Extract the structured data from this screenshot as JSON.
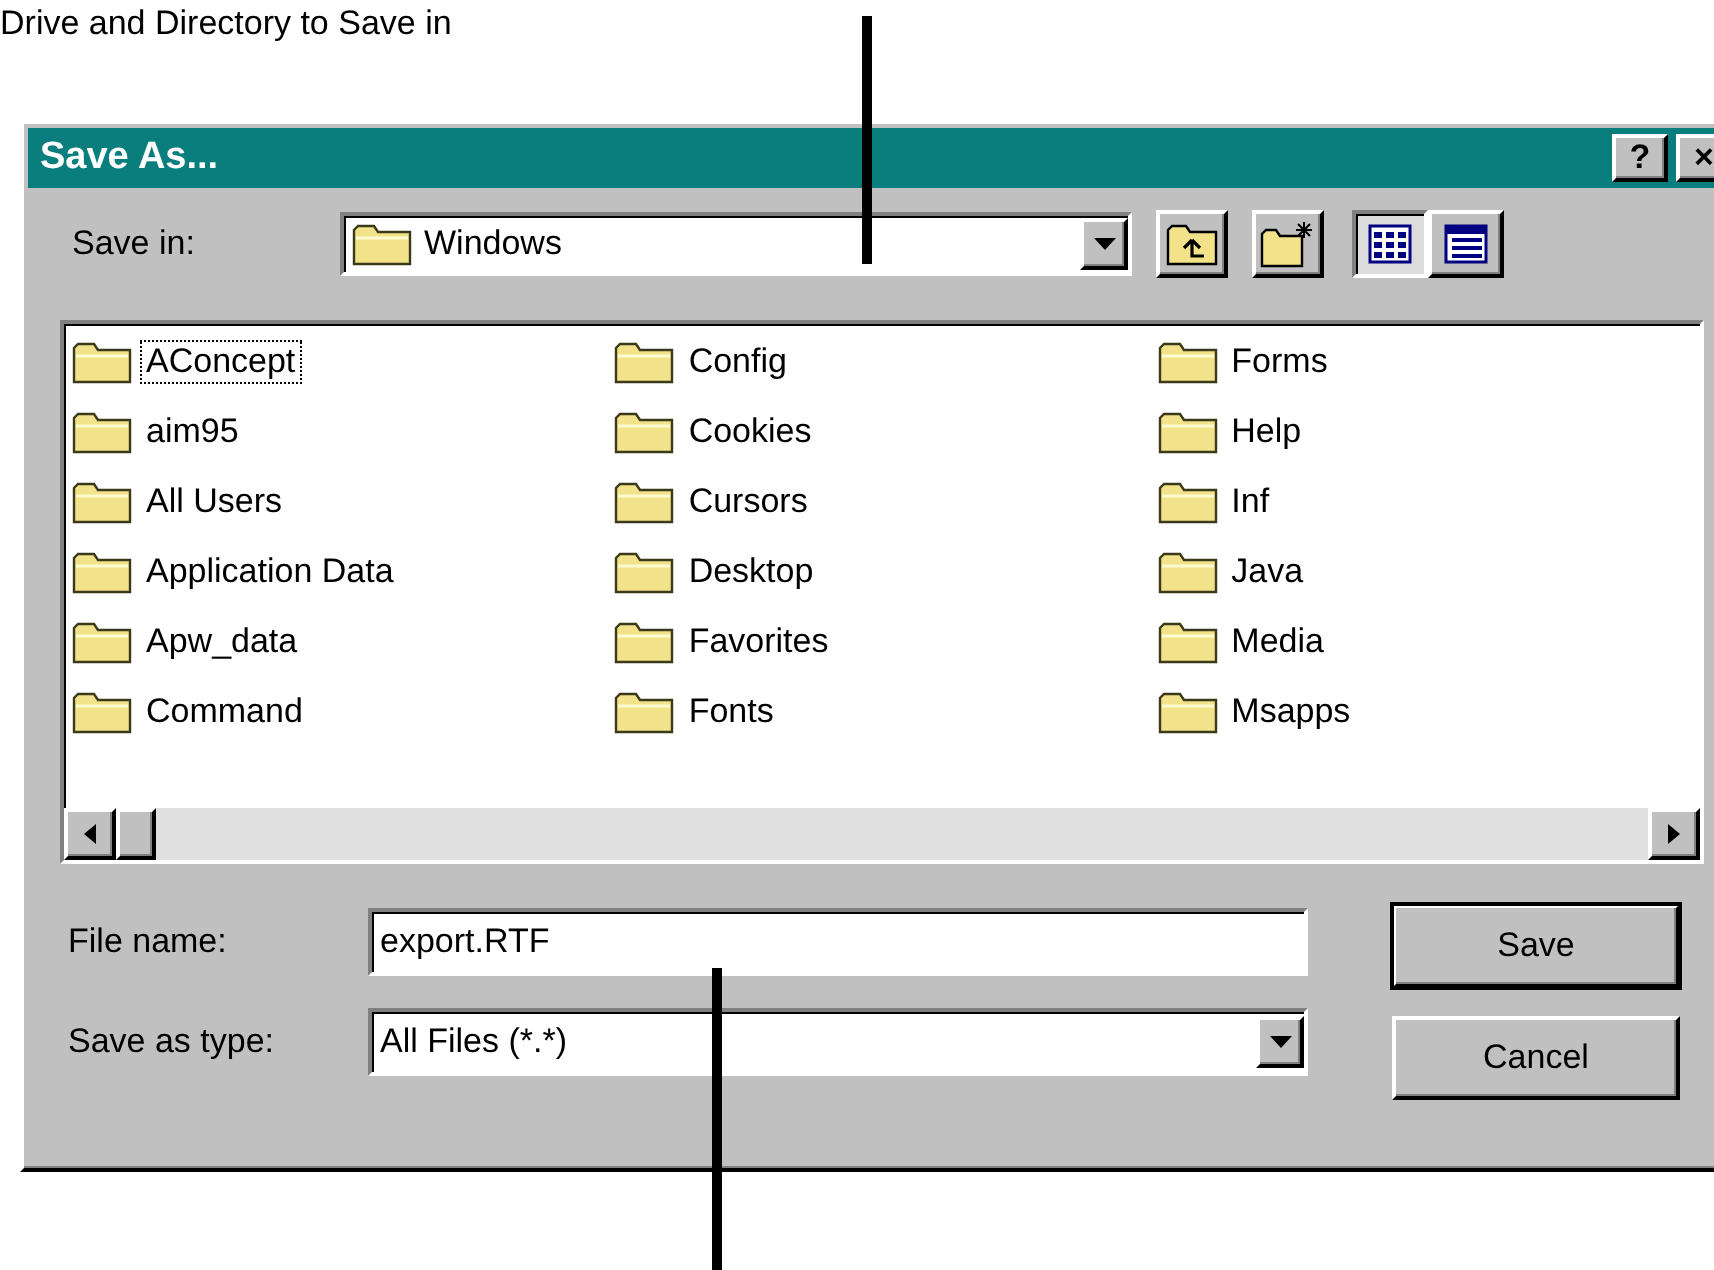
{
  "annotation_top": {
    "text": "Drive and Directory to Save in"
  },
  "window": {
    "title": "Save As...",
    "help_button": "?",
    "close_button": "×"
  },
  "save_in": {
    "label": "Save in:",
    "value": "Windows"
  },
  "view_buttons": [
    {
      "kind": "list",
      "selected": true
    },
    {
      "kind": "details",
      "selected": false
    }
  ],
  "folders": [
    {
      "name": "AConcept",
      "focused": true
    },
    {
      "name": "aim95",
      "focused": false
    },
    {
      "name": "All Users",
      "focused": false
    },
    {
      "name": "Application Data",
      "focused": false
    },
    {
      "name": "Apw_data",
      "focused": false
    },
    {
      "name": "Command",
      "focused": false
    },
    {
      "name": "Config",
      "focused": false
    },
    {
      "name": "Cookies",
      "focused": false
    },
    {
      "name": "Cursors",
      "focused": false
    },
    {
      "name": "Desktop",
      "focused": false
    },
    {
      "name": "Favorites",
      "focused": false
    },
    {
      "name": "Fonts",
      "focused": false
    },
    {
      "name": "Forms",
      "focused": false
    },
    {
      "name": "Help",
      "focused": false
    },
    {
      "name": "Inf",
      "focused": false
    },
    {
      "name": "Java",
      "focused": false
    },
    {
      "name": "Media",
      "focused": false
    },
    {
      "name": "Msapps",
      "focused": false
    }
  ],
  "file_name": {
    "label": "File name:",
    "value": "export.RTF"
  },
  "save_as_type": {
    "label": "Save as type:",
    "value": "All Files (*.*)"
  },
  "buttons": [
    {
      "label": "Save",
      "default": true
    },
    {
      "label": "Cancel",
      "default": false
    }
  ]
}
